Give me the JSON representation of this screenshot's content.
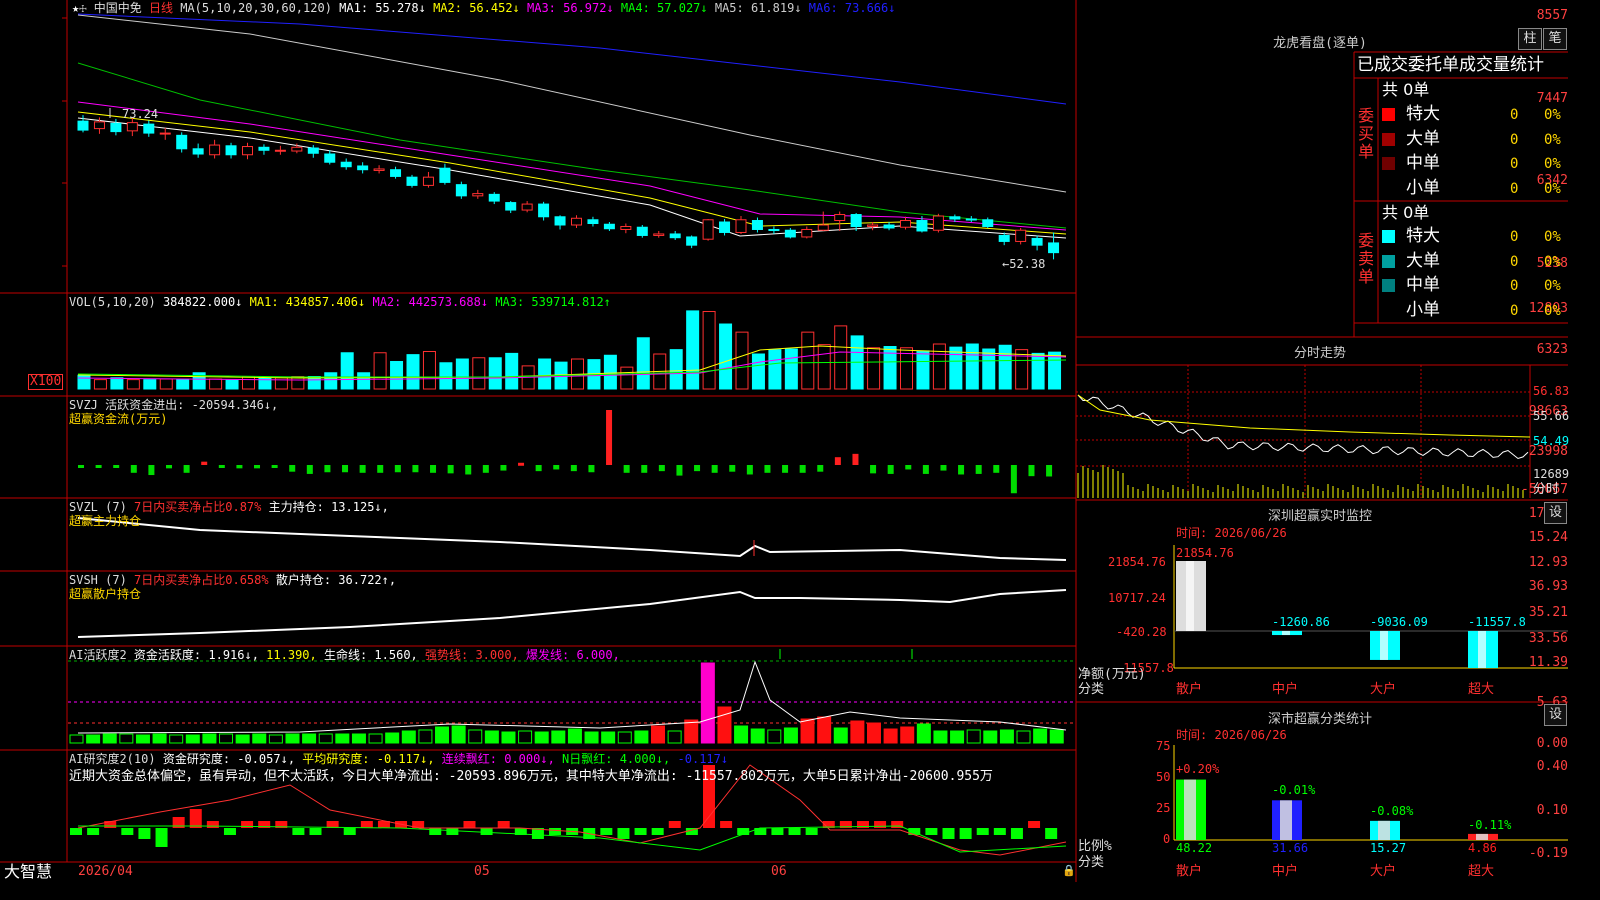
{
  "stock": {
    "name": "中国中免",
    "period": "日线"
  },
  "main": {
    "ma_title": "MA(5,10,20,30,60,120)",
    "ma": [
      {
        "label": "MA1: 55.278↓",
        "color": "#ffffff"
      },
      {
        "label": "MA2: 56.452↓",
        "color": "#ffff00"
      },
      {
        "label": "MA3: 56.972↓",
        "color": "#ff00ff"
      },
      {
        "label": "MA4: 57.027↓",
        "color": "#00ff00"
      },
      {
        "label": "MA5: 61.819↓",
        "color": "#cccccc"
      },
      {
        "label": "MA6: 73.666↓",
        "color": "#2020ff"
      }
    ],
    "axis": [
      "8557",
      "7447",
      "6342",
      "5238"
    ],
    "high_note": "73.24",
    "low_note": "←52.38"
  },
  "vol": {
    "title": "VOL(5,10,20)",
    "value": "384822.000↓",
    "ma": [
      {
        "label": "MA1: 434857.406↓",
        "color": "#ffff00"
      },
      {
        "label": "MA2: 442573.688↓",
        "color": "#ff00ff"
      },
      {
        "label": "MA3: 539714.812↑",
        "color": "#00ff00"
      }
    ],
    "axis": [
      "12803",
      "6323"
    ],
    "unit": "X100"
  },
  "svzj": {
    "title": "SVZJ  活跃资金进出: -20594.346↓,",
    "subtitle": "超赢资金流(万元)",
    "axis": [
      "98663",
      "23998",
      "-50667"
    ]
  },
  "svzl": {
    "title": "SVZL (7)",
    "t2": "7日内买卖净占比0.87%",
    "t3": "主力持仓: 13.125↓,",
    "subtitle": "超赢主力持仓",
    "axis": [
      "17.56",
      "15.24",
      "12.93"
    ]
  },
  "svsh": {
    "title": "SVSH (7)",
    "t2": "7日内买卖净占比0.658%",
    "t3": "散户持仓: 36.722↑,",
    "subtitle": "超赢散户持仓",
    "axis": [
      "36.93",
      "35.21",
      "33.56"
    ]
  },
  "ai1": {
    "title": "AI活跃度2",
    "items": [
      {
        "label": "资金活跃度: 1.916↓,",
        "color": "#ffffff"
      },
      {
        "label": "11.390,",
        "color": "#ffff00"
      },
      {
        "label": "生命线: 1.560,",
        "color": "#ffffff"
      },
      {
        "label": "强势线: 3.000,",
        "color": "#ff3030"
      },
      {
        "label": "爆发线: 6.000,",
        "color": "#ff00ff"
      }
    ],
    "axis": [
      "11.39",
      "5.63",
      "0.00"
    ]
  },
  "ai2": {
    "title": "AI研究度2(10)",
    "items": [
      {
        "label": "资金研究度: -0.057↓,",
        "color": "#ffffff"
      },
      {
        "label": "平均研究度: -0.117↓,",
        "color": "#ffff00"
      },
      {
        "label": "连续飘红: 0.000↓,",
        "color": "#ff00ff"
      },
      {
        "label": "N日飘红: 4.000↓,",
        "color": "#00ff00"
      },
      {
        "label": "-0.117↓",
        "color": "#2020ff"
      }
    ],
    "summary": "近期大资金总体偏空，虽有异动，但不太活跃，今日大单净流出: -20593.896万元，其中特大单净流出: -11557.802万元，大单5日累计净出-20600.955万",
    "axis": [
      "0.40",
      "0.10",
      "-0.19"
    ]
  },
  "xaxis": {
    "d1": "2026/04",
    "d2": "05",
    "d3": "06"
  },
  "brand": "大智慧",
  "lhb": {
    "title": "龙虎看盘(逐单)",
    "btn1": "柱",
    "btn2": "笔",
    "header": "已成交委托单成交量统计",
    "buy_label": "委买单",
    "sell_label": "委卖单",
    "buy_total": "共 0单",
    "sell_total": "共 0单",
    "buy_rows": [
      {
        "name": "特大",
        "count": "0",
        "pct": "0%",
        "color": "#ff0000"
      },
      {
        "name": "大单",
        "count": "0",
        "pct": "0%",
        "color": "#a00000"
      },
      {
        "name": "中单",
        "count": "0",
        "pct": "0%",
        "color": "#700000"
      },
      {
        "name": "小单",
        "count": "0",
        "pct": "0%",
        "color": "#000000"
      }
    ],
    "sell_rows": [
      {
        "name": "特大",
        "count": "0",
        "pct": "0%",
        "color": "#00ffff"
      },
      {
        "name": "大单",
        "count": "0",
        "pct": "0%",
        "color": "#00a0a0"
      },
      {
        "name": "中单",
        "count": "0",
        "pct": "0%",
        "color": "#008080"
      },
      {
        "name": "小单",
        "count": "0",
        "pct": "0%",
        "color": "#000000"
      }
    ]
  },
  "fenshi": {
    "title": "分时走势",
    "axis": [
      "56.83",
      "55.66",
      "54.49"
    ],
    "vol": "12689",
    "label": "分时"
  },
  "monitor": {
    "title": "深圳超赢实时监控",
    "btn": "设",
    "time": "时间: 2026/06/26",
    "axis": [
      "21854.76",
      "10717.24",
      "-420.28",
      "-11557.8"
    ],
    "ylabel": "净额(万元)",
    "xlabel": "分类",
    "cats": [
      "散户",
      "中户",
      "大户",
      "超大"
    ],
    "values": [
      21854.76,
      -1260.86,
      -9036.09,
      -11557.8
    ],
    "value_labels": [
      "21854.76",
      "-1260.86",
      "-9036.09",
      "-11557.8"
    ]
  },
  "classify": {
    "title": "深市超赢分类统计",
    "btn": "设",
    "time": "时间: 2026/06/26",
    "axis": [
      "75",
      "50",
      "25",
      "0"
    ],
    "ylabel": "比例%",
    "xlabel": "分类",
    "cats": [
      "散户",
      "中户",
      "大户",
      "超大"
    ],
    "values": [
      48.22,
      31.66,
      15.27,
      4.86
    ],
    "value_labels": [
      "48.22",
      "31.66",
      "15.27",
      "4.86"
    ],
    "change_labels": [
      "+0.20%",
      "-0.01%",
      "-0.08%",
      "-0.11%"
    ]
  },
  "chart_data": {
    "type": "candlestick",
    "n": 60,
    "ylim": [
      5238,
      8557
    ],
    "candles": [
      [
        7150,
        7030,
        7230,
        7000
      ],
      [
        7050,
        7140,
        7200,
        6980
      ],
      [
        7120,
        7010,
        7180,
        6960
      ],
      [
        7020,
        7130,
        7200,
        6950
      ],
      [
        7110,
        6990,
        7160,
        6940
      ],
      [
        6980,
        6990,
        7060,
        6900
      ],
      [
        6960,
        6780,
        7000,
        6730
      ],
      [
        6780,
        6710,
        6850,
        6660
      ],
      [
        6700,
        6830,
        6900,
        6650
      ],
      [
        6820,
        6700,
        6860,
        6650
      ],
      [
        6700,
        6810,
        6860,
        6640
      ],
      [
        6800,
        6760,
        6840,
        6700
      ],
      [
        6760,
        6760,
        6820,
        6700
      ],
      [
        6750,
        6800,
        6850,
        6720
      ],
      [
        6790,
        6720,
        6830,
        6660
      ],
      [
        6710,
        6600,
        6760,
        6570
      ],
      [
        6600,
        6540,
        6650,
        6500
      ],
      [
        6550,
        6500,
        6600,
        6450
      ],
      [
        6490,
        6510,
        6560,
        6450
      ],
      [
        6500,
        6410,
        6540,
        6380
      ],
      [
        6400,
        6290,
        6430,
        6260
      ],
      [
        6290,
        6400,
        6470,
        6260
      ],
      [
        6520,
        6330,
        6580,
        6300
      ],
      [
        6300,
        6150,
        6340,
        6110
      ],
      [
        6150,
        6180,
        6230,
        6110
      ],
      [
        6170,
        6080,
        6200,
        6040
      ],
      [
        6060,
        5960,
        6080,
        5920
      ],
      [
        5960,
        6040,
        6080,
        5930
      ],
      [
        6040,
        5870,
        6070,
        5820
      ],
      [
        5870,
        5760,
        5890,
        5700
      ],
      [
        5760,
        5850,
        5890,
        5720
      ],
      [
        5830,
        5780,
        5870,
        5740
      ],
      [
        5770,
        5710,
        5800,
        5680
      ],
      [
        5700,
        5740,
        5780,
        5650
      ],
      [
        5730,
        5620,
        5760,
        5590
      ],
      [
        5620,
        5640,
        5680,
        5590
      ],
      [
        5640,
        5590,
        5680,
        5560
      ],
      [
        5600,
        5490,
        5620,
        5450
      ],
      [
        5570,
        5830,
        5840,
        5550
      ],
      [
        5800,
        5660,
        5840,
        5620
      ],
      [
        5660,
        5830,
        5880,
        5640
      ],
      [
        5820,
        5700,
        5860,
        5660
      ],
      [
        5700,
        5690,
        5740,
        5640
      ],
      [
        5690,
        5600,
        5720,
        5580
      ],
      [
        5600,
        5700,
        5740,
        5580
      ],
      [
        5690,
        5760,
        5940,
        5680
      ],
      [
        5820,
        5900,
        5940,
        5680
      ],
      [
        5900,
        5740,
        5920,
        5680
      ],
      [
        5740,
        5760,
        5800,
        5690
      ],
      [
        5760,
        5720,
        5800,
        5690
      ],
      [
        5730,
        5820,
        5870,
        5700
      ],
      [
        5820,
        5680,
        5880,
        5660
      ],
      [
        5690,
        5880,
        5910,
        5660
      ],
      [
        5870,
        5840,
        5900,
        5800
      ],
      [
        5840,
        5830,
        5880,
        5800
      ],
      [
        5830,
        5740,
        5860,
        5720
      ],
      [
        5620,
        5540,
        5660,
        5490
      ],
      [
        5540,
        5690,
        5720,
        5500
      ],
      [
        5580,
        5490,
        5620,
        5420
      ],
      [
        5520,
        5390,
        5660,
        5300
      ]
    ],
    "vol": [
      2200,
      1500,
      1800,
      1500,
      1500,
      1600,
      1500,
      2600,
      1600,
      1400,
      2000,
      1700,
      1800,
      2000,
      2000,
      2600,
      5800,
      2600,
      5800,
      4400,
      5500,
      6000,
      4200,
      4800,
      5000,
      5000,
      5700,
      3700,
      4800,
      4300,
      4800,
      4700,
      5400,
      3500,
      8200,
      5600,
      6300,
      12500,
      12400,
      10400,
      9100,
      5600,
      6300,
      6400,
      9100,
      7100,
      10100,
      8500,
      6600,
      6800,
      6600,
      6100,
      7200,
      6700,
      7200,
      6400,
      7000,
      6300,
      5700,
      5900,
      4400
    ],
    "svzj": [
      -2000,
      -3000,
      -3000,
      -14000,
      -18000,
      -6000,
      -14000,
      6000,
      -5000,
      -6000,
      -6000,
      -4000,
      -12000,
      -16000,
      -13000,
      -13000,
      -14000,
      -14000,
      -13000,
      -13000,
      -14000,
      -15000,
      -17000,
      -14000,
      -10000,
      4000,
      -11000,
      -8000,
      -11000,
      -13000,
      98663,
      -14000,
      -14000,
      -11000,
      -19000,
      -11000,
      -14000,
      -12000,
      -17000,
      -14000,
      -14000,
      -14000,
      -12000,
      14000,
      20000,
      -15000,
      -16000,
      -8000,
      -16000,
      -10000,
      -17000,
      -16000,
      -14000,
      -50667,
      -20000,
      -20594
    ]
  }
}
